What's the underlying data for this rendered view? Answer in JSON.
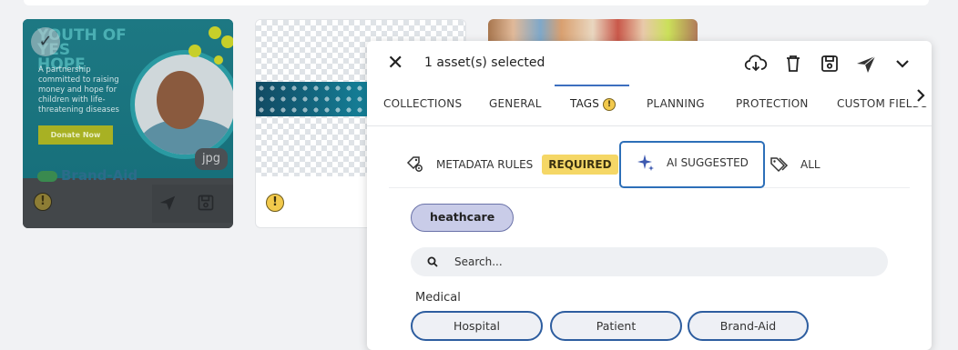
{
  "assets": [
    {
      "headline_lines": [
        "YOUTH OF",
        "YES",
        "HOPE"
      ],
      "blurb": "A partnership committed to raising money and hope for children with life-threatening diseases",
      "donate_label": "Donate Now",
      "brand": "Brand-Aid",
      "file_type": "jpg",
      "warning_symbol": "!",
      "selected": true
    },
    {
      "warning_symbol": "!",
      "selected": false
    },
    {
      "selected": false
    }
  ],
  "panel": {
    "selection_label": "1 asset(s) selected",
    "icons": [
      "close-icon",
      "download-icon",
      "trash-icon",
      "save-icon",
      "send-icon",
      "chevron-down-icon"
    ],
    "tabs": [
      {
        "label": "COLLECTIONS"
      },
      {
        "label": "GENERAL"
      },
      {
        "label": "TAGS",
        "badge": "!"
      },
      {
        "label": "PLANNING"
      },
      {
        "label": "PROTECTION"
      },
      {
        "label": "CUSTOM FIELDS"
      }
    ],
    "active_tab": "TAGS",
    "subtabs": {
      "metadata_rules": "METADATA RULES",
      "required_badge": "REQUIRED",
      "ai_suggested": "AI SUGGESTED",
      "all": "ALL"
    },
    "active_subtab": "AI SUGGESTED",
    "selected_tags": [
      "heathcare"
    ],
    "search": {
      "placeholder": "Search...",
      "value": ""
    },
    "groups": [
      {
        "title": "Medical",
        "tags": [
          "Hospital",
          "Patient",
          "Brand-Aid"
        ]
      }
    ],
    "colors": {
      "accent": "#3d6fbf",
      "warning": "#f2c94c",
      "selected_chip": "#c9cce8",
      "chip_border": "#2d5d9f"
    }
  }
}
